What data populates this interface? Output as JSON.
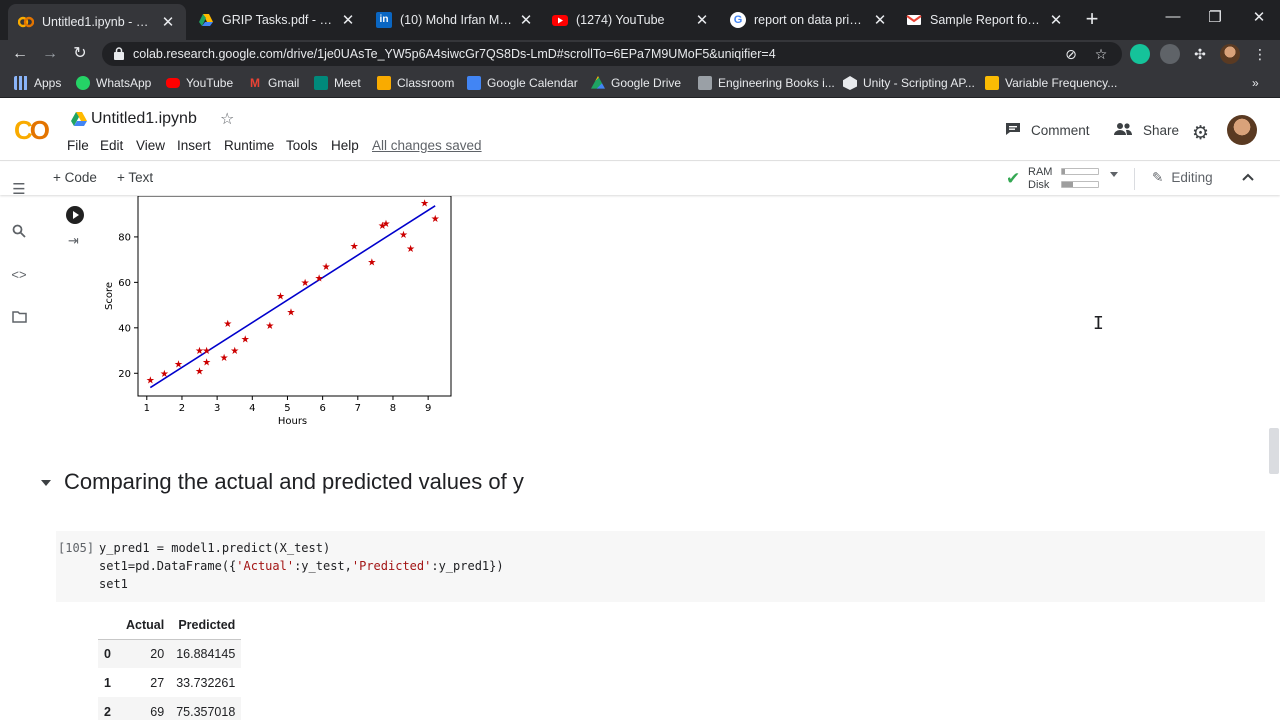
{
  "browser": {
    "tabs": [
      {
        "title": "Untitled1.ipynb - Colab",
        "icon": "colab-favicon",
        "color": "#f9ab00",
        "active": true
      },
      {
        "title": "GRIP Tasks.pdf - Google",
        "icon": "drive-favicon",
        "color": "#1fa463",
        "active": false
      },
      {
        "title": "(10) Mohd Irfan Mohd",
        "icon": "linkedin-favicon",
        "color": "#0a66c2",
        "active": false
      },
      {
        "title": "(1274) YouTube",
        "icon": "youtube-favicon",
        "color": "#ff0000",
        "active": false
      },
      {
        "title": "report on data privacy",
        "icon": "google-favicon",
        "color": "#4285f4",
        "active": false
      },
      {
        "title": "Sample Report for Guid",
        "icon": "gmail-favicon",
        "color": "#ea4335",
        "active": false
      }
    ],
    "url": "colab.research.google.com/drive/1je0UAsTe_YW5p6A4siwcGr7QS8Ds-LmD#scrollTo=6EPa7M9UMoF5&uniqifier=4",
    "bookmarks": [
      {
        "label": "Apps",
        "icon": "apps-grid-icon",
        "color": "#8ab4f8"
      },
      {
        "label": "WhatsApp",
        "icon": "whatsapp-icon",
        "color": "#25d366"
      },
      {
        "label": "YouTube",
        "icon": "youtube-icon",
        "color": "#ff0000"
      },
      {
        "label": "Gmail",
        "icon": "gmail-icon",
        "color": "#ea4335"
      },
      {
        "label": "Meet",
        "icon": "meet-icon",
        "color": "#00897b"
      },
      {
        "label": "Classroom",
        "icon": "classroom-icon",
        "color": "#f9ab00"
      },
      {
        "label": "Google Calendar",
        "icon": "calendar-icon",
        "color": "#4285f4"
      },
      {
        "label": "Google Drive",
        "icon": "drive-icon",
        "color": "#1fa463"
      },
      {
        "label": "Engineering Books i...",
        "icon": "books-icon",
        "color": "#9aa0a6"
      },
      {
        "label": "Unity - Scripting AP...",
        "icon": "unity-icon",
        "color": "#e8eaed"
      },
      {
        "label": "Variable Frequency...",
        "icon": "document-icon",
        "color": "#f28b82"
      }
    ]
  },
  "colab": {
    "notebook_title": "Untitled1.ipynb",
    "menu": [
      "File",
      "Edit",
      "View",
      "Insert",
      "Runtime",
      "Tools",
      "Help"
    ],
    "save_status": "All changes saved",
    "comment_label": "Comment",
    "share_label": "Share",
    "toolbar": {
      "add_code": "+ Code",
      "add_text": "+ Text",
      "ram_label": "RAM",
      "disk_label": "Disk",
      "ram_usage": 0.08,
      "disk_usage": 0.3,
      "editing_label": "Editing"
    }
  },
  "notebook": {
    "section_title": "Comparing the actual and predicted values of y",
    "cell": {
      "exec_count": "[105]",
      "lines": [
        "y_pred1 = model1.predict(X_test)",
        "set1=pd.DataFrame({'Actual':y_test,'Predicted':y_pred1})",
        "set1"
      ]
    },
    "dataframe": {
      "columns": [
        "",
        "Actual",
        "Predicted"
      ],
      "rows": [
        {
          "index": "0",
          "actual": "20",
          "predicted": "16.884145"
        },
        {
          "index": "1",
          "actual": "27",
          "predicted": "33.732261"
        },
        {
          "index": "2",
          "actual": "69",
          "predicted": "75.357018"
        }
      ]
    }
  },
  "chart_data": {
    "type": "scatter",
    "title": "",
    "xlabel": "Hours",
    "ylabel": "Score",
    "xticks": [
      1,
      2,
      3,
      4,
      5,
      6,
      7,
      8,
      9
    ],
    "yticks": [
      20,
      40,
      60,
      80
    ],
    "xlim": [
      0.75,
      9.65
    ],
    "ylim": [
      10,
      98
    ],
    "marker_color": "#cc0000",
    "line_color": "#0000cc",
    "points": [
      {
        "x": 1.1,
        "y": 17
      },
      {
        "x": 1.5,
        "y": 20
      },
      {
        "x": 1.9,
        "y": 24
      },
      {
        "x": 2.5,
        "y": 21
      },
      {
        "x": 2.5,
        "y": 30
      },
      {
        "x": 2.7,
        "y": 25
      },
      {
        "x": 2.7,
        "y": 30
      },
      {
        "x": 3.2,
        "y": 27
      },
      {
        "x": 3.3,
        "y": 42
      },
      {
        "x": 3.5,
        "y": 30
      },
      {
        "x": 3.8,
        "y": 35
      },
      {
        "x": 4.5,
        "y": 41
      },
      {
        "x": 4.8,
        "y": 54
      },
      {
        "x": 5.1,
        "y": 47
      },
      {
        "x": 5.5,
        "y": 60
      },
      {
        "x": 5.9,
        "y": 62
      },
      {
        "x": 6.1,
        "y": 67
      },
      {
        "x": 6.9,
        "y": 76
      },
      {
        "x": 7.4,
        "y": 69
      },
      {
        "x": 7.7,
        "y": 85
      },
      {
        "x": 7.8,
        "y": 86
      },
      {
        "x": 8.3,
        "y": 81
      },
      {
        "x": 8.5,
        "y": 75
      },
      {
        "x": 8.9,
        "y": 95
      },
      {
        "x": 9.2,
        "y": 88
      }
    ],
    "regression_line": [
      {
        "x": 1.1,
        "y": 13.7
      },
      {
        "x": 9.2,
        "y": 93.7
      }
    ]
  }
}
